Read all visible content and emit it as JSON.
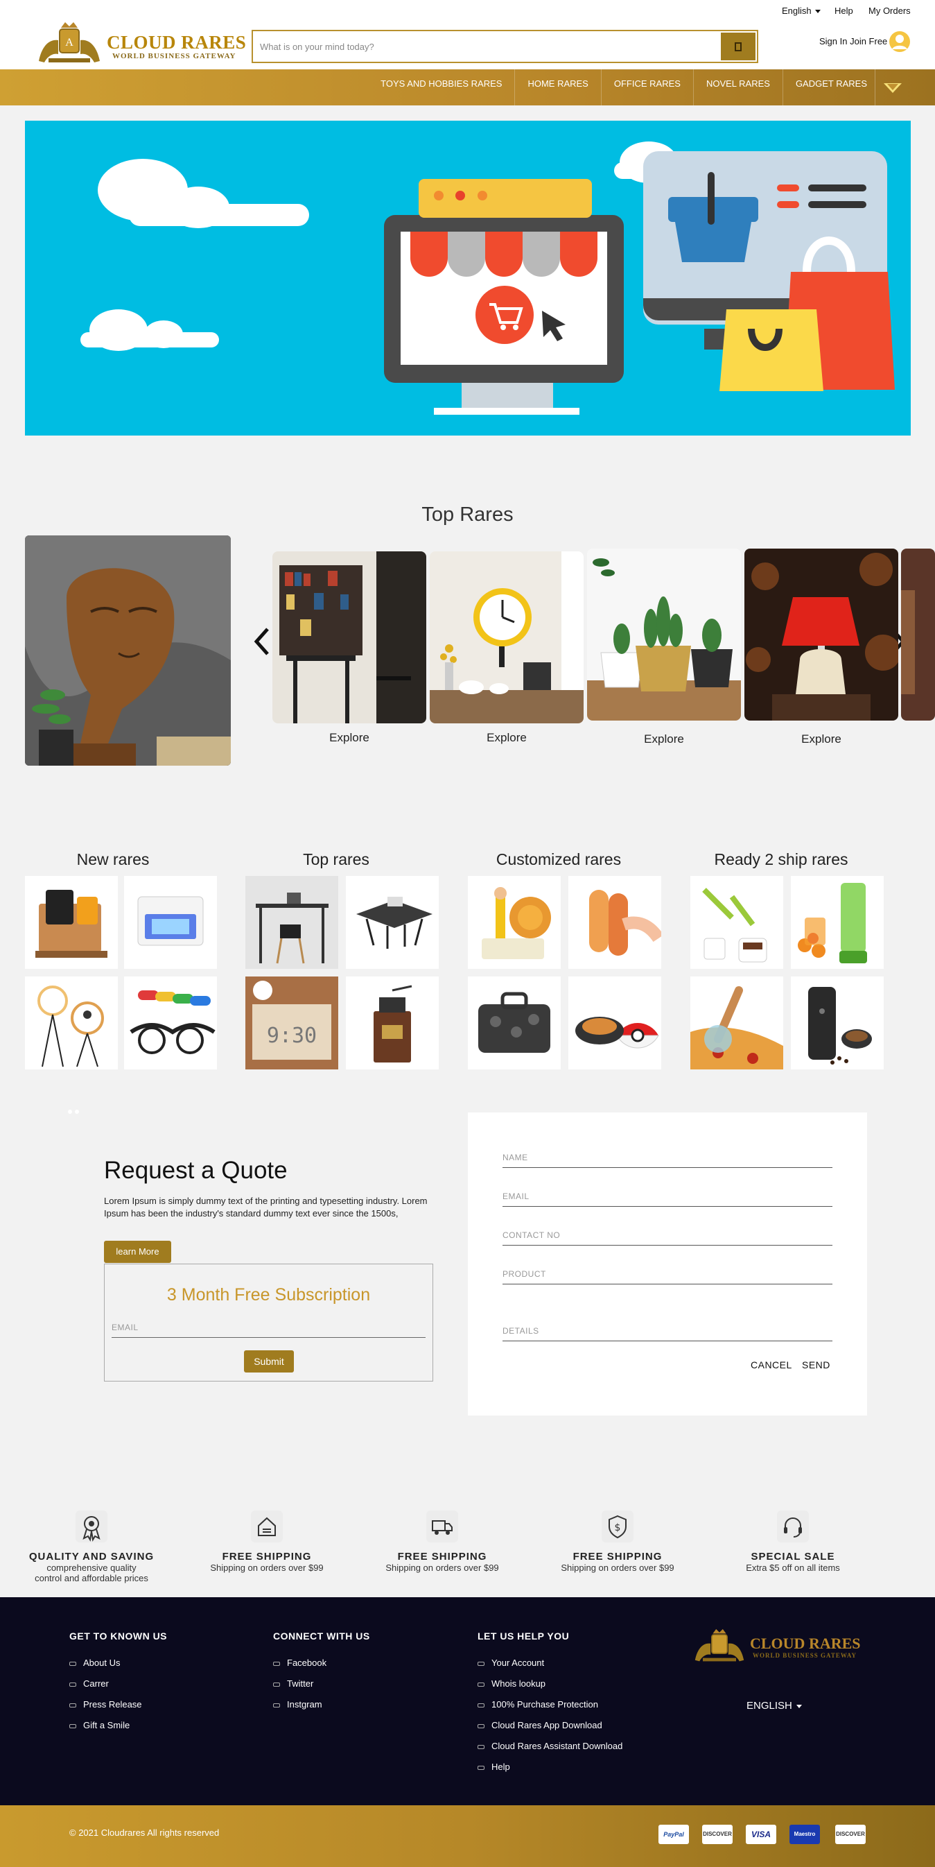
{
  "util": {
    "language": "English",
    "help": "Help",
    "orders": "My Orders"
  },
  "brand": {
    "name": "CLOUD RARES",
    "tagline": "WORLD BUSINESS GATEWAY"
  },
  "search": {
    "placeholder": "What is on your mind today?"
  },
  "account": {
    "signin": "Sign In Join Free"
  },
  "nav": {
    "items": [
      "TOYS AND HOBBIES RARES",
      "HOME RARES",
      "OFFICE RARES",
      "NOVEL RARES",
      "GADGET RARES"
    ]
  },
  "top_rares": {
    "title": "Top Rares",
    "tiles": [
      {
        "label": "Explore"
      },
      {
        "label": "Explore"
      },
      {
        "label": "Explore"
      },
      {
        "label": "Explore"
      }
    ]
  },
  "categories": [
    {
      "title": "New rares"
    },
    {
      "title": "Top rares"
    },
    {
      "title": "Customized rares"
    },
    {
      "title": "Ready 2 ship rares"
    }
  ],
  "quote": {
    "title": "Request a Quote",
    "text": "Lorem Ipsum is simply dummy text of the printing and typesetting industry. Lorem Ipsum has been the industry's standard dummy text ever since the 1500s,",
    "learn_more": "learn More",
    "subscription_title": "3 Month Free Subscription",
    "email_placeholder": "EMAIL",
    "submit": "Submit"
  },
  "form": {
    "name_placeholder": "NAME",
    "email_placeholder": "EMAIL",
    "contact_placeholder": "CONTACT NO",
    "product_placeholder": "PRODUCT",
    "details_placeholder": "DETAILS",
    "cancel": "CANCEL",
    "send": "SEND"
  },
  "features": [
    {
      "icon": "award-icon",
      "title": "QUALITY AND SAVING",
      "sub1": "comprehensive quality",
      "sub2": "control and affordable prices"
    },
    {
      "icon": "house-icon",
      "title": "FREE SHIPPING",
      "sub1": "Shipping on orders over $99",
      "sub2": ""
    },
    {
      "icon": "truck-icon",
      "title": "FREE SHIPPING",
      "sub1": "Shipping on orders over $99",
      "sub2": ""
    },
    {
      "icon": "shield-dollar-icon",
      "title": "FREE SHIPPING",
      "sub1": "Shipping on orders over $99",
      "sub2": ""
    },
    {
      "icon": "headset-icon",
      "title": "SPECIAL SALE",
      "sub1": "Extra $5 off on all items",
      "sub2": ""
    }
  ],
  "footer": {
    "col1": {
      "title": "GET TO KNOWN US",
      "links": [
        "About Us",
        "Carrer",
        "Press Release",
        "Gift a Smile"
      ]
    },
    "col2": {
      "title": "CONNECT WITH US",
      "links": [
        "Facebook",
        "Twitter",
        "Instgram"
      ]
    },
    "col3": {
      "title": "LET US HELP YOU",
      "links": [
        "Your Account",
        "Whois lookup",
        "100% Purchase Protection",
        "Cloud Rares App Download",
        "Cloud Rares Assistant Download",
        "Help"
      ]
    },
    "language": "ENGLISH",
    "copyright": "© 2021 Cloudrares All rights reserved",
    "payments": [
      "PayPal",
      "DISCOVER",
      "VISA",
      "Maestro",
      "DISCOVER"
    ]
  },
  "colors": {
    "gold": "#b8862a",
    "hero_blue": "#00bde2",
    "footer_bg": "#0b0a1e"
  }
}
